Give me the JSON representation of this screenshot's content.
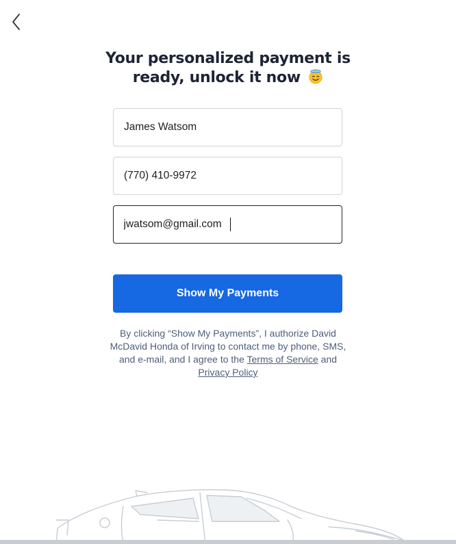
{
  "heading": {
    "line1": "Your personalized payment is",
    "line2": "ready, unlock it now",
    "emoji_icon": "smiling-face-with-halo-icon"
  },
  "form": {
    "name_value": "James Watsom",
    "phone_value": "(770) 410-9972",
    "email_value": "jwatsom@gmail.com"
  },
  "cta": {
    "label": "Show My Payments"
  },
  "disclaimer": {
    "text_before": "By clicking “Show My Payments”, I authorize David McDavid Honda of Irving to contact me by phone, SMS, and e-mail, and I agree to the ",
    "terms_link": "Terms of Service",
    "conjunction": " and ",
    "privacy_link": "Privacy Policy"
  },
  "colors": {
    "accent": "#1668e3",
    "heading_text": "#1c2435",
    "muted_text": "#4d5e78",
    "border": "#cfd3d9"
  },
  "icons": {
    "back": "chevron-left-icon",
    "illustration": "car-outline-icon"
  }
}
